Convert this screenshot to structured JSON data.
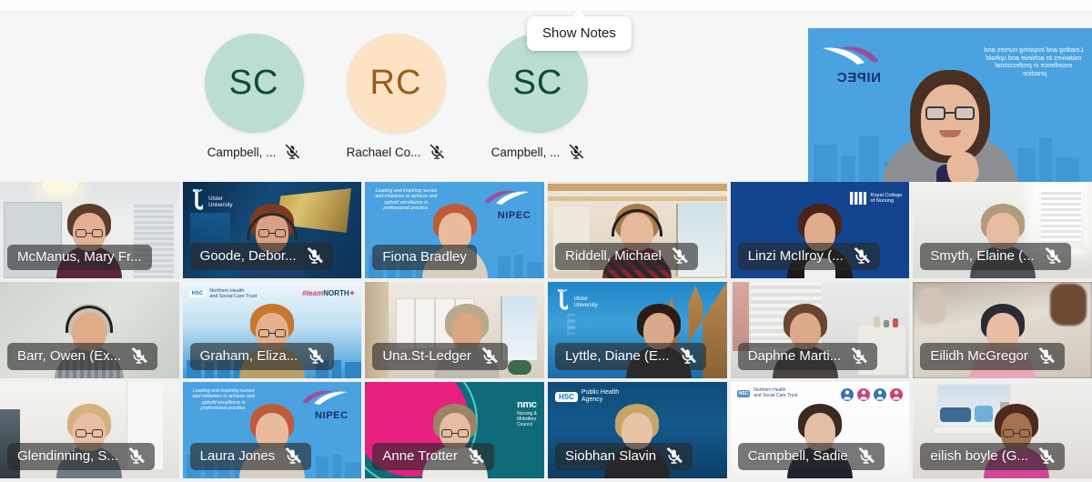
{
  "app": {
    "tooltip": {
      "label": "Show Notes"
    },
    "top_ghost_left": "",
    "top_ghost_right": ""
  },
  "speaker_strip": {
    "avatars": [
      {
        "initials": "SC",
        "name": "Campbell, ...",
        "circle_color": "#bcded2",
        "text_color": "#0d4a38",
        "muted": true,
        "mic_icon": "mic-muted-icon"
      },
      {
        "initials": "RC",
        "name": "Rachael Co...",
        "circle_color": "#fbe3c4",
        "text_color": "#9a5c16",
        "muted": true,
        "mic_icon": "mic-muted-icon"
      },
      {
        "initials": "SC",
        "name": "Campbell, ...",
        "circle_color": "#bcded2",
        "text_color": "#0d4a38",
        "muted": true,
        "mic_icon": "mic-muted-icon"
      }
    ],
    "featured_tile": {
      "background_kind": "nipec-brand",
      "brand_name": "NIPEC",
      "brand_tagline": "Leading and inspiring nurses and midwives to achieve and uphold excellence in professional practice.",
      "brand_bg_color": "#4aa3e0",
      "mirrored": true,
      "name": ""
    }
  },
  "grid": {
    "rows": [
      [
        {
          "name": "McManus, Mary Fr...",
          "muted": false,
          "background_kind": "room-office",
          "mic_icon": "mic-muted-icon"
        },
        {
          "name": "Goode, Debor...",
          "muted": true,
          "background_kind": "ulster-university",
          "brand_name": "Ulster University",
          "mic_icon": "mic-muted-icon"
        },
        {
          "name": "Fiona Bradley",
          "muted": false,
          "background_kind": "nipec-brand",
          "brand_name": "NIPEC",
          "brand_tagline": "Leading and inspiring nurses and midwives to achieve and uphold excellence in professional practice.",
          "mic_icon": "mic-muted-icon"
        },
        {
          "name": "Riddell, Michael",
          "muted": true,
          "background_kind": "room-wood",
          "mic_icon": "mic-muted-icon"
        },
        {
          "name": "Linzi McIlroy (...",
          "muted": true,
          "background_kind": "royal-college-nursing",
          "brand_name": "Royal College of Nursing",
          "mic_icon": "mic-muted-icon"
        },
        {
          "name": "Smyth, Elaine (...",
          "muted": true,
          "background_kind": "room-bright",
          "mic_icon": "mic-muted-icon"
        }
      ],
      [
        {
          "name": "Barr, Owen (Ex...",
          "muted": true,
          "background_kind": "room-plain-green",
          "mic_icon": "mic-muted-icon"
        },
        {
          "name": "Graham, Eliza...",
          "muted": true,
          "background_kind": "northern-trust",
          "brand_name": "Northern Health and Social Care Trust",
          "brand_tagline": "#teamNORTH",
          "mic_icon": "mic-muted-icon"
        },
        {
          "name": "Una.St-Ledger",
          "muted": true,
          "background_kind": "room-modern-interior",
          "mic_icon": "mic-muted-icon"
        },
        {
          "name": "Lyttle, Diane (E...",
          "muted": true,
          "background_kind": "ulster-university-campus",
          "brand_name": "Ulster University",
          "mic_icon": "mic-muted-icon"
        },
        {
          "name": "Daphne Marti...",
          "muted": true,
          "background_kind": "room-blinds",
          "mic_icon": "mic-muted-icon"
        },
        {
          "name": "Eilidh McGregor",
          "muted": true,
          "background_kind": "room-blurred",
          "mic_icon": "mic-muted-icon"
        }
      ],
      [
        {
          "name": "Glendinning, S...",
          "muted": true,
          "background_kind": "room-white-wall",
          "mic_icon": "mic-muted-icon"
        },
        {
          "name": "Laura Jones",
          "muted": true,
          "background_kind": "nipec-brand",
          "brand_name": "NIPEC",
          "brand_tagline": "Leading and inspiring nurses and midwives to achieve and uphold excellence in professional practice.",
          "mic_icon": "mic-muted-icon"
        },
        {
          "name": "Anne Trotter",
          "muted": true,
          "background_kind": "nmc-brand",
          "brand_name": "nmc",
          "brand_tagline": "Nursing & Midwifery Council",
          "mic_icon": "mic-muted-icon"
        },
        {
          "name": "Siobhan Slavin",
          "muted": true,
          "background_kind": "public-health-agency",
          "brand_name": "HSC",
          "brand_tagline": "Public Health Agency",
          "mic_icon": "mic-muted-icon"
        },
        {
          "name": "Campbell, Sadie",
          "muted": true,
          "background_kind": "northern-trust-white",
          "brand_name": "Northern Health and Social Care Trust",
          "mic_icon": "mic-muted-icon"
        },
        {
          "name": "eilish boyle (G...",
          "muted": true,
          "background_kind": "room-window",
          "mic_icon": "mic-muted-icon"
        }
      ]
    ]
  }
}
